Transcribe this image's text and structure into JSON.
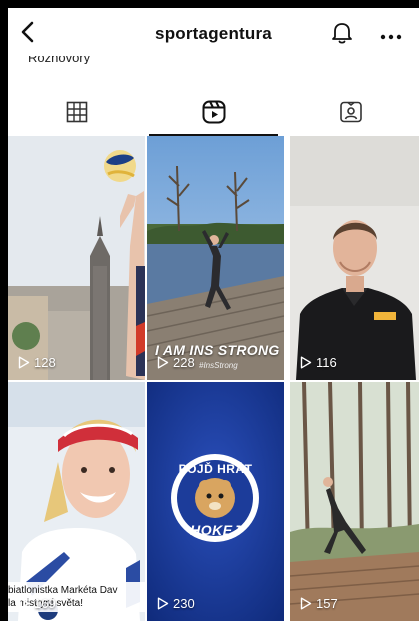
{
  "header": {
    "title": "sportagentura",
    "peek_label": "Rozhovory"
  },
  "tabs": [
    {
      "name": "grid",
      "icon": "grid-icon"
    },
    {
      "name": "reels",
      "icon": "reels-icon",
      "active": true
    },
    {
      "name": "tagged",
      "icon": "tagged-icon"
    }
  ],
  "reels": [
    {
      "views": "128"
    },
    {
      "views": "228",
      "overlay": "I AM INS STRONG",
      "signature": "#InsStrong"
    },
    {
      "views": "116"
    },
    {
      "views": "169",
      "caption_line1": "biatlonistka Markéta Dav",
      "caption_line2": "la mistryní světa!"
    },
    {
      "views": "230",
      "logo_top": "POJĎ HRÁT",
      "logo_bottom": "HOKEJ"
    },
    {
      "views": "157"
    }
  ],
  "colors": {
    "background": "#ffffff",
    "text": "#111111",
    "frame": "#000000"
  }
}
